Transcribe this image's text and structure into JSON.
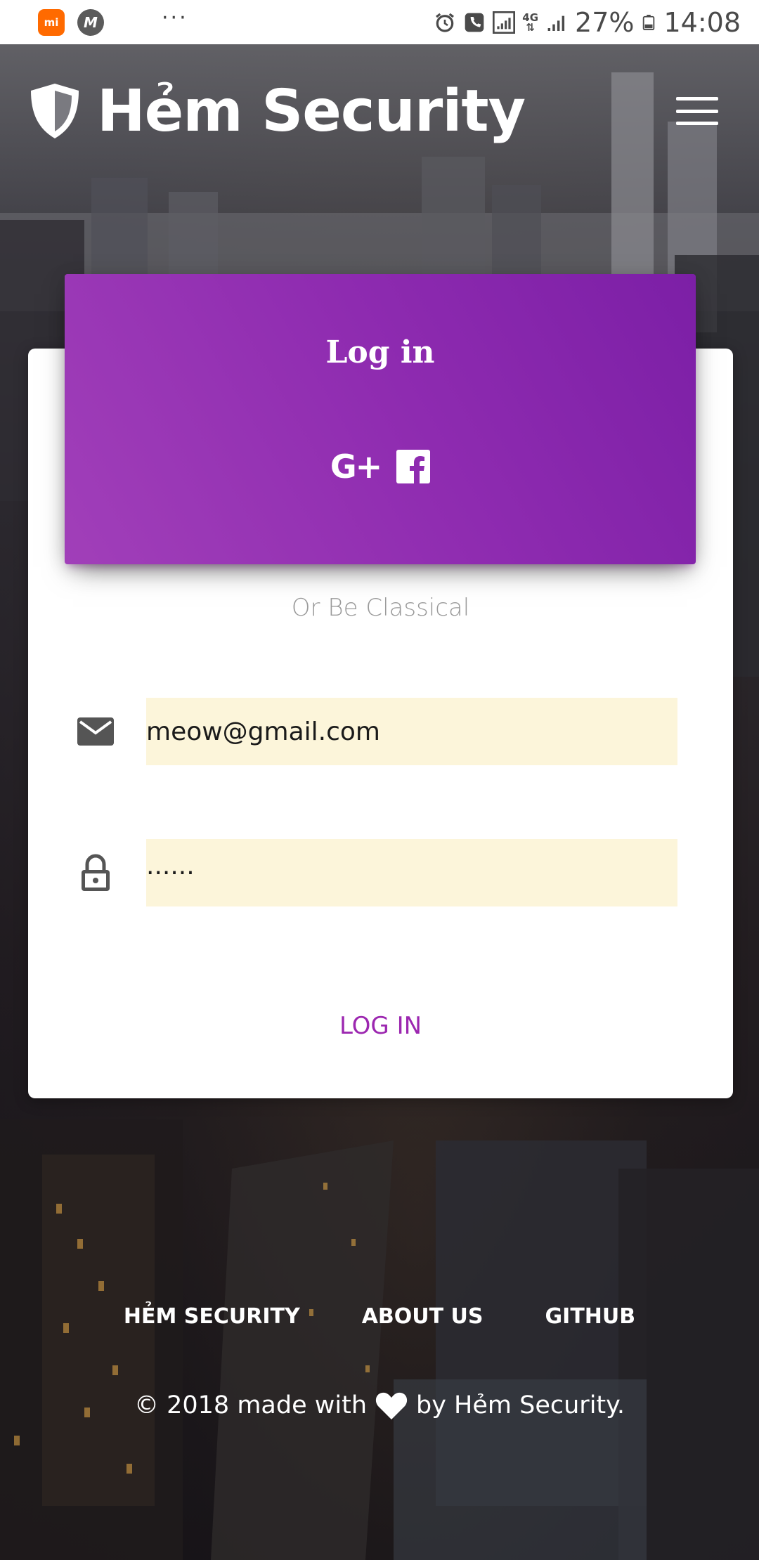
{
  "status_bar": {
    "dots": "···",
    "battery": "27%",
    "time": "14:08",
    "network": "4G"
  },
  "header": {
    "brand_title": "Hẻm Security",
    "icons": [
      "shield-icon",
      "menu-icon"
    ]
  },
  "login_card": {
    "title": "Log in",
    "social": {
      "google_label": "G+",
      "facebook_icon": "facebook-icon"
    },
    "subtitle": "Or Be Classical",
    "email": {
      "value": "meow@gmail.com",
      "icon": "email-icon"
    },
    "password": {
      "value": "······",
      "icon": "lock-icon"
    },
    "submit_label": "LOG IN",
    "colors": {
      "header_start": "#a13fb9",
      "header_end": "#7c1fa6",
      "input_bg": "#fcf5da",
      "accent": "#9c27b0"
    }
  },
  "footer": {
    "links": [
      "HẺM SECURITY",
      "ABOUT US",
      "GITHUB"
    ],
    "copyright_before": "© 2018 made with",
    "copyright_after": "by Hẻm Security."
  }
}
